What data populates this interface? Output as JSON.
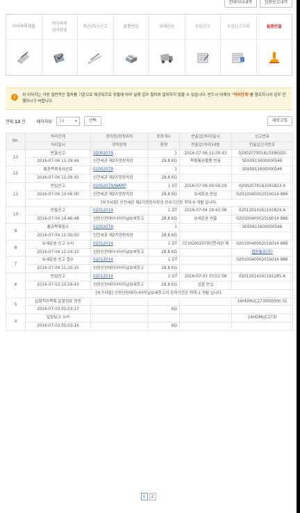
{
  "top_buttons": [
    "컨테이너내역",
    "입항보고내역"
  ],
  "steps": [
    {
      "label": "적하목록제출",
      "icon": "pencil-paper-icon",
      "active": false
    },
    {
      "label": "적하목록\n심사완료",
      "icon": "checked-box-icon",
      "active": false
    },
    {
      "label": "하선/하기신고",
      "icon": "unload-ramp-icon",
      "active": false
    },
    {
      "label": "물품반입",
      "icon": "cargo-boxes-icon",
      "active": false
    },
    {
      "label": "보세운송",
      "icon": "truck-icon",
      "active": false
    },
    {
      "label": "수입신고",
      "icon": "report-form-icon",
      "active": false
    },
    {
      "label": "수입신고수리",
      "icon": "approved-form-icon",
      "active": false
    },
    {
      "label": "물품반출",
      "icon": "stamp-icon",
      "active": true
    }
  ],
  "notice": {
    "pre": "위 이미지는 가장 일반적인 절차를 기준으로 제공되므로 상황에 따라 실제 업무 절차와 일치하지 않을 수 있습니다. 반드시 아래의 ",
    "highlight": "\"처리단계\"",
    "post": "를 참조하시어 업무 진행하시기 바랍니다."
  },
  "controls": {
    "total_label": "전체",
    "total_count": "13",
    "total_unit": "건",
    "page_size_label": "페이지당",
    "page_size_value": "10",
    "select_button": "선택",
    "refresh_button": "새로고침"
  },
  "headers": {
    "no": "No.",
    "r1": [
      "처리단계",
      "장치장/장치위치",
      "포장개수",
      "반출입(처리)일시",
      "신고번호"
    ],
    "r2": [
      "처리일시",
      "장치장명",
      "중량",
      "반출입(처리)내용",
      "반출입근거번호"
    ]
  },
  "records": [
    {
      "no": "13",
      "step": "반출신고",
      "code": "02002079",
      "pkg": "1",
      "io_dt": "2016-07-06 11:39:43",
      "decl": "02002079016L0396320",
      "dt": "2016-07-06 11:39:46",
      "wh": "인천세관 제2지정장치장",
      "wt": "28.8 KG",
      "io_desc": "목록통관물품 반출",
      "basis": "SE00911600000546"
    },
    {
      "no": "12",
      "step": "통관목록심사완료",
      "code": "02002079",
      "pkg": "1",
      "io_dt": "",
      "decl": "SE00911600000546",
      "dt": "2016-07-06 11:39:45",
      "wh": "인천세관 제2지정장치장",
      "wt": "28.8 KG",
      "io_desc": "",
      "basis": ""
    },
    {
      "no": "11",
      "step": "반입신고",
      "code": "02002079/WARP",
      "pkg": "1 GT",
      "io_dt": "2016-07-06 09:59:29",
      "decl": "02002079163041823 9",
      "dt": "2016-07-06 10:06:00",
      "wh": "인천세관 제2지정장치장",
      "wt": "28.8 KG",
      "io_desc": "보세운송 반입",
      "basis": "02010040002016014 886",
      "note": "[부가사항] 인천세관 제2지정장치장의 장치기간은 최대 6 개월 입니다."
    },
    {
      "no": "10",
      "step": "반출신고",
      "code": "02012014",
      "pkg": "1 GT",
      "io_dt": "2016-07-04 19:43:38",
      "decl": "02012014161161824 A",
      "dt": "2016-07-04 19:46:48",
      "wh": "선광신컨테이너터미널보세창고",
      "wt": "28.8 KG",
      "io_desc": "보세운송 반출",
      "basis": "02010040002016014 886"
    },
    {
      "no": "9",
      "step": "통관목록접수",
      "code": "02002079",
      "pkg": "1",
      "io_dt": "",
      "decl": "SE00911600000546",
      "dt": "2016-07-04 11:30:50",
      "wh": "인천세관 제2지정장치장",
      "wt": "28.8 KG",
      "io_desc": "",
      "basis": ""
    },
    {
      "no": "8",
      "step": "보세운송 신고 수리",
      "code": "02012014",
      "pkg": "1 GT",
      "io_dt": "(도)02002079인천세관 제",
      "decl": "02010040002016014 886",
      "dt": "2016-07-04 11:14:10",
      "wh": "선광신컨테이너터미널보세창고",
      "wt": "28.8 KG",
      "io_desc": "",
      "basis": "협동통운(주)"
    },
    {
      "no": "7",
      "step": "보세운송 신고 접수",
      "code": "02012014",
      "pkg": "1 GT",
      "io_dt": "",
      "decl": "02010040002016014 886",
      "dt": "2016-07-04 11:10:35",
      "wh": "선광신컨테이너터미널보세창고",
      "wt": "28.8 KG",
      "io_desc": "",
      "basis": ""
    },
    {
      "no": "6",
      "step": "반입신고",
      "code": "02012014",
      "pkg": "1 GT",
      "io_dt": "2016-07-03 10:52:58",
      "decl": "02012014161161285 A",
      "dt": "2016-07-03 10:59:43",
      "wh": "선광신컨테이너터미널보세창고",
      "wt": "28.8 KG",
      "io_desc": "입항 반입",
      "basis": "",
      "note": "[부가사항] 선광신컨테이너터미널보세창고의 장치기간은 최대 2 개월 입니다."
    },
    {
      "no": "5",
      "step": "입항적하목록 운항정보 정정",
      "code": "",
      "pkg": "",
      "io_dt": "",
      "decl": "16HDMUC273I000000 01",
      "dt": "2016-07-03 05:03:17",
      "wh": "",
      "wt": "KG",
      "io_desc": "",
      "basis": ""
    },
    {
      "no": "4",
      "step": "입항보고 수리",
      "code": "",
      "pkg": "",
      "io_dt": "",
      "decl": "16HDMUC273I",
      "dt": "2016-07-03 05:03:16",
      "wh": "",
      "wt": "KG",
      "io_desc": "",
      "basis": ""
    }
  ],
  "pagination": [
    "1",
    "2"
  ]
}
